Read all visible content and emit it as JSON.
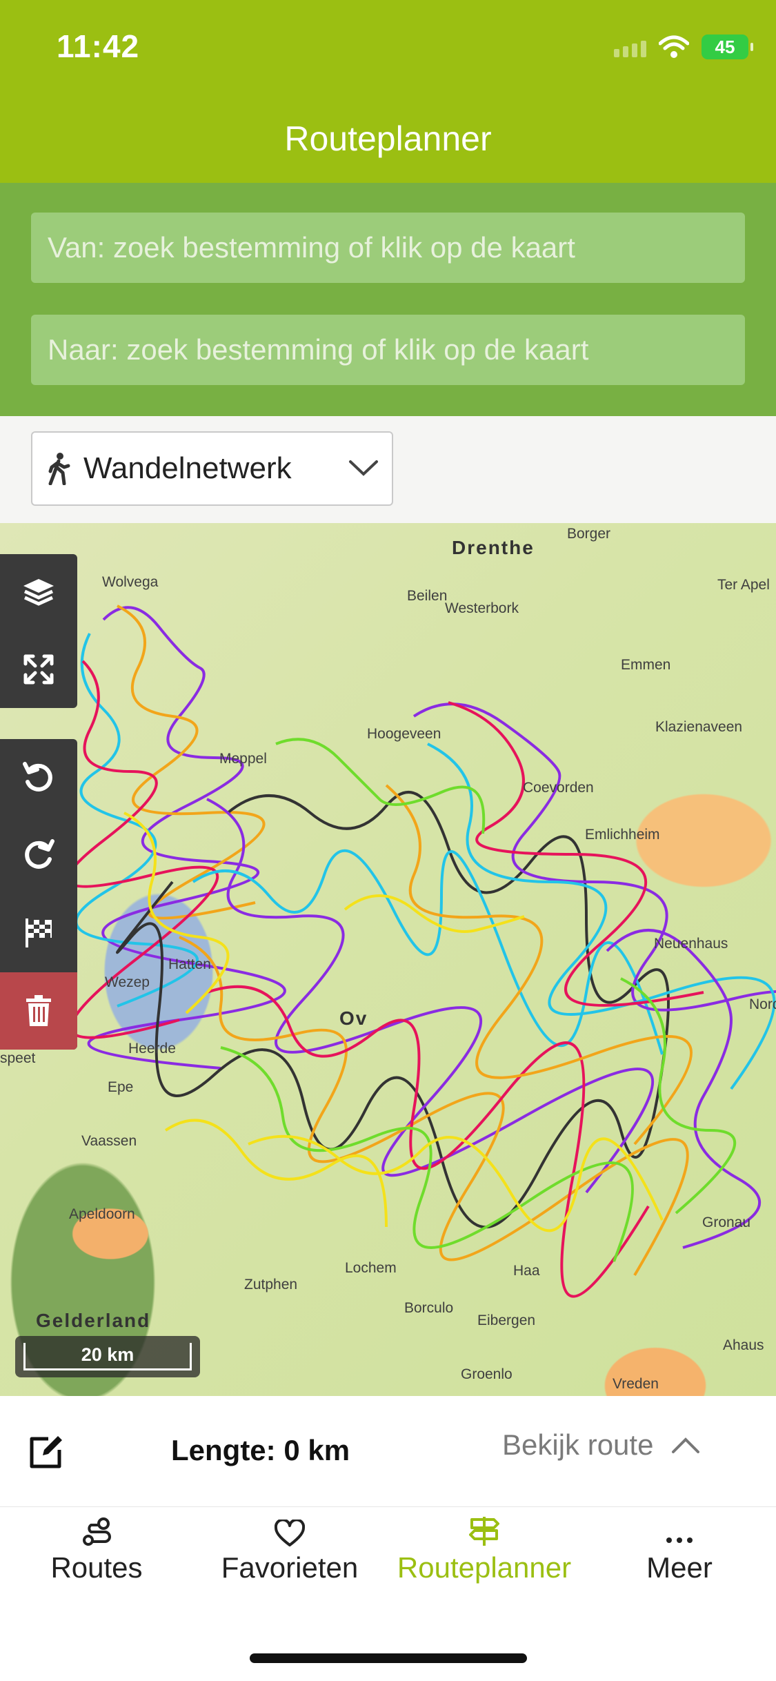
{
  "status_bar": {
    "time": "11:42",
    "battery": "45"
  },
  "header": {
    "title": "Routeplanner"
  },
  "search": {
    "from_placeholder": "Van: zoek bestemming of klik op de kaart",
    "to_placeholder": "Naar: zoek bestemming of klik op de kaart"
  },
  "mode_selector": {
    "value": "Wandelnetwerk",
    "icon": "walking-person-icon"
  },
  "map": {
    "labels": [
      "Drenthe",
      "Borger",
      "Wolvega",
      "Beilen",
      "Westerbork",
      "Ter Apel",
      "Emmen",
      "Klazienaveen",
      "Hoogeveen",
      "Meppel",
      "Coevorden",
      "Emlichheim",
      "Neuenhaus",
      "Hatten",
      "Wezep",
      "Ov",
      "Heerde",
      "Epe",
      "Vaassen",
      "Apeldoorn",
      "Lochem",
      "Zutphen",
      "Borculo",
      "Eibergen",
      "Gelderland",
      "Groenlo",
      "Vreden",
      "Ahaus",
      "Gronau",
      "Nord",
      "speet",
      "Haa"
    ],
    "scale": "20 km",
    "controls": [
      "layers-icon",
      "fit-bounds-icon",
      "undo-icon",
      "redo-icon",
      "finish-flag-icon",
      "trash-icon"
    ]
  },
  "info_bar": {
    "length": "Lengte: 0 km",
    "view_route": "Bekijk route"
  },
  "tabs": [
    {
      "label": "Routes",
      "icon": "route-icon"
    },
    {
      "label": "Favorieten",
      "icon": "heart-icon"
    },
    {
      "label": "Routeplanner",
      "icon": "signpost-icon"
    },
    {
      "label": "Meer",
      "icon": "more-dots-icon"
    }
  ],
  "colors": {
    "header": "#9bbf12",
    "search_band": "#78b043",
    "active_tab": "#9bbf12",
    "delete": "#b8474b"
  }
}
